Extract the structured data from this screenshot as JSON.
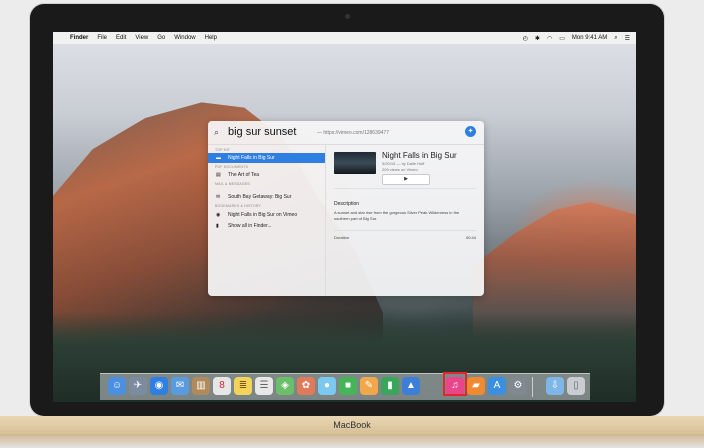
{
  "menubar": {
    "apple": "",
    "items": [
      "Finder",
      "File",
      "Edit",
      "View",
      "Go",
      "Window",
      "Help"
    ],
    "clock": "Mon 9:41 AM"
  },
  "spotlight": {
    "query": "big sur sunset",
    "suggestion": "— https://vimeo.com/128639477",
    "sections": [
      "TOP HIT",
      "PDF DOCUMENTS",
      "MAIL & MESSAGES",
      "BOOKMARKS & HISTORY"
    ],
    "results": [
      {
        "label": "Night Falls in Big Sur",
        "icon": "video-icon",
        "glyph": "▬"
      },
      {
        "label": "The Art of Tea",
        "icon": "pdf-icon",
        "glyph": "▤"
      },
      {
        "label": "South Bay Getaway: Big Sur",
        "icon": "mail-icon",
        "glyph": "✉"
      },
      {
        "label": "Night Falls in Big Sur on Vimeo",
        "icon": "safari-icon",
        "glyph": "◉"
      },
      {
        "label": "Show all in Finder...",
        "icon": "finder-icon",
        "glyph": "▮"
      }
    ],
    "preview": {
      "title": "Night Falls in Big Sur",
      "meta1": "5/20/15 — by Dalle Huff",
      "meta2": "209 views on Vimeo",
      "play": "▶",
      "desc_heading": "Description",
      "description": "A sunset and star rise from the gorgeous Silver Peak Wilderness in the southern part of Big Sur.",
      "duration_label": "Duration",
      "duration_value": "00:44"
    }
  },
  "laptop": {
    "brand": "MacBook"
  },
  "dock": {
    "items": [
      {
        "name": "finder-icon",
        "glyph": "☺",
        "color": "#4a8fe0"
      },
      {
        "name": "launchpad-icon",
        "glyph": "✈",
        "color": "#7c8ca0"
      },
      {
        "name": "safari-icon",
        "glyph": "◉",
        "color": "#2f7fe3"
      },
      {
        "name": "mail-icon",
        "glyph": "✉",
        "color": "#5a9be0"
      },
      {
        "name": "contacts-icon",
        "glyph": "▥",
        "color": "#b08a5a"
      },
      {
        "name": "calendar-icon",
        "glyph": "8",
        "color": "#e6e6e6"
      },
      {
        "name": "notes-icon",
        "glyph": "≣",
        "color": "#f3d35a"
      },
      {
        "name": "reminders-icon",
        "glyph": "☰",
        "color": "#e7e7e7"
      },
      {
        "name": "maps-icon",
        "glyph": "◈",
        "color": "#6cbf6a"
      },
      {
        "name": "photos-icon",
        "glyph": "✿",
        "color": "#e07a5a"
      },
      {
        "name": "messages-icon",
        "glyph": "●",
        "color": "#7cc9f0"
      },
      {
        "name": "facetime-icon",
        "glyph": "■",
        "color": "#46b55a"
      },
      {
        "name": "pages-icon",
        "glyph": "✎",
        "color": "#f0a84a"
      },
      {
        "name": "numbers-icon",
        "glyph": "▮",
        "color": "#3aa65a"
      },
      {
        "name": "keynote-icon",
        "glyph": "▲",
        "color": "#3d7fd8"
      },
      {
        "name": "itunes-icon",
        "glyph": "♫",
        "color": "#e8458a"
      },
      {
        "name": "ibooks-icon",
        "glyph": "▰",
        "color": "#f08a30"
      },
      {
        "name": "app-store-icon",
        "glyph": "A",
        "color": "#3a8fe0"
      },
      {
        "name": "system-preferences-icon",
        "glyph": "⚙",
        "color": "#808890"
      },
      {
        "name": "downloads-folder-icon",
        "glyph": "⇩",
        "color": "#7fb6e8"
      },
      {
        "name": "trash-icon",
        "glyph": "▯",
        "color": "#c9cdd2"
      }
    ]
  },
  "colors": {
    "accent": "#2f7fe3",
    "highlight": "#e4262a",
    "aluminum": "#e9d6b3"
  }
}
